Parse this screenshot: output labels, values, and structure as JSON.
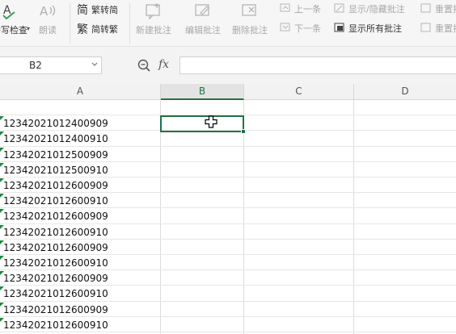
{
  "ribbon": {
    "spellcheck_label": "拼写检查",
    "read_label": "朗读",
    "trad_to_simp_label": "繁转简",
    "simp_to_trad_label": "简转繁",
    "new_comment_label": "新建批注",
    "edit_comment_label": "编辑批注",
    "delete_comment_label": "删除批注",
    "prev_label": "上一条",
    "next_label": "下一条",
    "show_hide_comment_label": "显示/隐藏批注",
    "show_all_comments_label": "显示所有批注",
    "reset_label": "重置批注",
    "reset2_label": "重置批注"
  },
  "formula_bar": {
    "name_box": "B2",
    "fx_label": "fx",
    "formula_value": ""
  },
  "grid": {
    "columns": [
      "A",
      "B",
      "C",
      "D"
    ],
    "active_column": "B",
    "column_a_values": [
      "",
      "12342021012400909",
      "12342021012400910",
      "12342021012500909",
      "12342021012500910",
      "12342021012600909",
      "12342021012600910",
      "12342021012600909",
      "12342021012600910",
      "12342021012600909",
      "12342021012600910",
      "12342021012600909",
      "12342021012600910",
      "12342021012600909",
      "12342021012600910"
    ]
  },
  "colors": {
    "accent": "#217346",
    "error_triangle": "#1e8a3c",
    "ribbon_bg": "#f6f6f6",
    "grid_line": "#dcdcdc"
  },
  "icons": {
    "spellcheck": "spellcheck-icon",
    "read": "read-aloud-icon",
    "new_comment": "new-comment-icon",
    "zoom": "zoom-icon",
    "cursor": "cell-cursor-icon"
  }
}
